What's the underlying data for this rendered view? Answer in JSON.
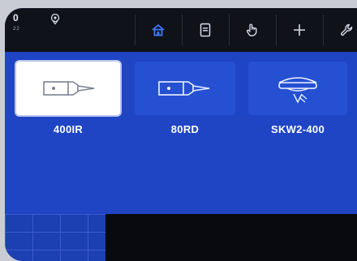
{
  "status": {
    "time": "0",
    "subtext": "22",
    "location_icon": "location-pin-icon"
  },
  "nav": [
    {
      "icon": "home-icon",
      "active": true
    },
    {
      "icon": "document-icon",
      "active": false
    },
    {
      "icon": "hand-pointer-icon",
      "active": false
    },
    {
      "icon": "plus-icon",
      "active": false
    },
    {
      "icon": "wrench-icon",
      "active": false
    }
  ],
  "devices": [
    {
      "label": "400IR",
      "icon": "laser-sensor-icon",
      "selected": true
    },
    {
      "label": "80RD",
      "icon": "radar-sensor-icon",
      "selected": false
    },
    {
      "label": "SKW2-400",
      "icon": "hanging-radar-icon",
      "selected": false
    }
  ],
  "colors": {
    "accent": "#1f45c4",
    "topbar": "#0f1219",
    "tile": "#2550d2"
  }
}
